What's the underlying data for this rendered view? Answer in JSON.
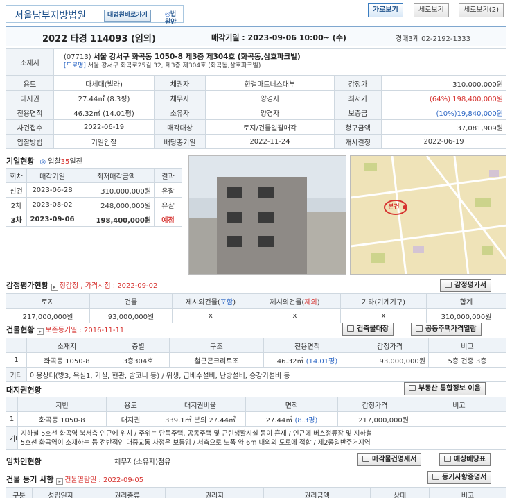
{
  "header": {
    "court_name": "서울남부지방법원",
    "court_link": "대법원바로가기",
    "map_link": "법원안내",
    "view_buttons": [
      "가로보기",
      "세로보기",
      "세로보기(2)"
    ]
  },
  "case": {
    "number": "2022 타경 114093 (임의)",
    "sale_date": "매각기일 : 2023-09-06 10:00~ (수)",
    "dept": "경매3계 02-2192-1333"
  },
  "location": {
    "label": "소재지",
    "postal": "(07713)",
    "address": "서울 강서구 화곡동 1050-8 제3층 제304호 (화곡동,삼호파크빌)",
    "road_tag": "[도로명]",
    "road_address": "서울 강서구 화곡로25길 32, 제3층 제304호 (화곡동,삼호파크빌)"
  },
  "summary": [
    [
      "용도",
      "다세대(빌라)",
      "채권자",
      "한걸마트너스대부",
      "감정가",
      "310,000,000원"
    ],
    [
      "대지권",
      "27.44㎡ (8.3평)",
      "채무자",
      "양경자",
      "최저가",
      "(64%) 198,400,000원"
    ],
    [
      "전용면적",
      "46.32㎡ (14.01평)",
      "소유자",
      "양경자",
      "보증금",
      "(10%)19,840,000원"
    ],
    [
      "사건접수",
      "2022-06-19",
      "매각대상",
      "토지/건물일괄매각",
      "청구금액",
      "37,081,909원"
    ],
    [
      "입찰방법",
      "기일입찰",
      "배당종기일",
      "2022-11-24",
      "개시결정",
      "2022-06-19"
    ]
  ],
  "auction": {
    "title": "기일현황",
    "d_prefix": "입찰",
    "d_num": "35",
    "d_suffix": "일전",
    "headers": [
      "회차",
      "매각기일",
      "최저매각금액",
      "결과"
    ],
    "rows": [
      [
        "신건",
        "2023-06-28",
        "310,000,000원",
        "유찰"
      ],
      [
        "2차",
        "2023-08-02",
        "248,000,000원",
        "유찰"
      ],
      [
        "3차",
        "2023-09-06",
        "198,400,000원",
        "예정"
      ]
    ]
  },
  "appraisal": {
    "title": "감정평가현황",
    "sub": "정감정 , 가격시점 : 2022-09-02",
    "button": "감정평가서",
    "headers": [
      "토지",
      "건물",
      "제시외건물(포함)",
      "제시외건물(제외)",
      "기타(기계기구)",
      "합계"
    ],
    "values": [
      "217,000,000원",
      "93,000,000원",
      "x",
      "x",
      "x",
      "310,000,000원"
    ],
    "h3_pre": "제시외건물(",
    "h3_in": "포함",
    "h4_pre": "제시외건물(",
    "h4_in": "제외",
    "h_close": ")"
  },
  "building": {
    "title": "건물현황",
    "sub": "보존등기일 : 2016-11-11",
    "btn1": "건축물대장",
    "btn2": "공동주택가격열람",
    "headers": [
      "소재지",
      "층별",
      "구조",
      "전용면적",
      "감정가격",
      "비고"
    ],
    "row": [
      "1",
      "화곡동 1050-8",
      "3층304호",
      "철근콘크리트조",
      "46.32㎡",
      "(14.01평)",
      "93,000,000원",
      "5층 건중 3층"
    ],
    "etc_label": "기타",
    "etc_text": "이용상태(방3, 욕실1, 거실, 현관, 발코니 등) / 위생, 급배수설비, 난방설비, 승강기설비 등"
  },
  "land": {
    "title": "대지권현황",
    "button": "부동산 통합정보 이음",
    "headers": [
      "지번",
      "용도",
      "대지권비율",
      "면적",
      "감정가격",
      "비고"
    ],
    "row": [
      "1",
      "화곡동 1050-8",
      "대지권",
      "339.1㎡ 분의 27.44㎡",
      "27.44㎡",
      "(8.3평)",
      "217,000,000원",
      ""
    ],
    "etc_label": "기타",
    "etc_text1": "지하철 5호선 화곡역 북서측 인근에 위치 / 주위는 단독주택, 공동주택 및 근린생활시설 등이 혼재 / 인근에 버스정류장 및 지하철",
    "etc_text2": "5호선 화곡역이 소재하는 등 전반적인 대중교통 사정은 보통임 / 서측으로 노폭 약 6m 내외의 도로에 접함 / 제2종일반주거지역"
  },
  "lease": {
    "title": "임차인현황",
    "text": "채무자(소유자)점유",
    "btn1": "매각물건명세서",
    "btn2": "예상배당표"
  },
  "registry": {
    "title": "건물 등기 사항",
    "sub": "건물열람일 : 2022-09-05",
    "button": "등기사항증명서",
    "headers": [
      "구분",
      "성립일자",
      "권리종류",
      "권리자",
      "권리금액",
      "상태",
      "비고"
    ]
  },
  "map": {
    "label": "본건"
  },
  "colors": {
    "accent": "#1b4f8a",
    "red": "#d6322f",
    "blue": "#2a65c4"
  }
}
